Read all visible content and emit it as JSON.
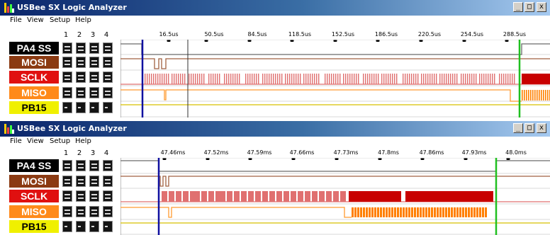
{
  "windows": [
    {
      "title": "USBee SX Logic Analyzer",
      "menu": [
        "File",
        "View",
        "Setup",
        "Help"
      ],
      "controls": [
        "_",
        "□",
        "x"
      ],
      "trigger_columns": [
        "1",
        "2",
        "3",
        "4"
      ],
      "time_ticks": [
        "16.5us",
        "50.5us",
        "84.5us",
        "118.5us",
        "152.5us",
        "186.5us",
        "220.5us",
        "254.5us",
        "288.5us"
      ],
      "signals": [
        {
          "label": "PA4 SS",
          "bg": "#000000",
          "fg": "#ffffff",
          "trig": [
            "hi",
            "hi",
            "hi",
            "hi"
          ]
        },
        {
          "label": "MOSI",
          "bg": "#8b3a12",
          "fg": "#ffffff",
          "trig": [
            "hi",
            "hi",
            "hi",
            "hi"
          ]
        },
        {
          "label": "SCLK",
          "bg": "#e01010",
          "fg": "#ffffff",
          "trig": [
            "hi",
            "hi",
            "hi",
            "hi"
          ]
        },
        {
          "label": "MISO",
          "bg": "#ff8a1a",
          "fg": "#ffffff",
          "trig": [
            "hi",
            "hi",
            "hi",
            "hi"
          ]
        },
        {
          "label": "PB15",
          "bg": "#f0f000",
          "fg": "#000000",
          "trig": [
            "dc",
            "dc",
            "dc",
            "dc"
          ]
        }
      ]
    },
    {
      "title": "USBee SX Logic Analyzer",
      "menu": [
        "File",
        "View",
        "Setup",
        "Help"
      ],
      "controls": [
        "_",
        "□",
        "x"
      ],
      "trigger_columns": [
        "1",
        "2",
        "3",
        "4"
      ],
      "time_ticks": [
        "47.46ms",
        "47.52ms",
        "47.59ms",
        "47.66ms",
        "47.73ms",
        "47.8ms",
        "47.86ms",
        "47.93ms",
        "48.0ms"
      ],
      "signals": [
        {
          "label": "PA4 SS",
          "bg": "#000000",
          "fg": "#ffffff",
          "trig": [
            "hi",
            "hi",
            "hi",
            "hi"
          ]
        },
        {
          "label": "MOSI",
          "bg": "#8b3a12",
          "fg": "#ffffff",
          "trig": [
            "hi",
            "hi",
            "hi",
            "hi"
          ]
        },
        {
          "label": "SCLK",
          "bg": "#e01010",
          "fg": "#ffffff",
          "trig": [
            "hi",
            "hi",
            "hi",
            "hi"
          ]
        },
        {
          "label": "MISO",
          "bg": "#ff8a1a",
          "fg": "#ffffff",
          "trig": [
            "hi",
            "hi",
            "hi",
            "hi"
          ]
        },
        {
          "label": "PB15",
          "bg": "#f0f000",
          "fg": "#000000",
          "trig": [
            "dc",
            "dc",
            "dc",
            "dc"
          ]
        }
      ]
    }
  ],
  "colors": {
    "ss_line": "#6b6b6b",
    "mosi_line": "#a06040",
    "sclk_fill": "#c80000",
    "sclk_pulse": "#e07070",
    "miso_line": "#ff9a30",
    "miso_fill": "#ff8000",
    "pb15_line": "#d8c000",
    "cursor_blue": "#1010a0",
    "cursor_green": "#20c020"
  }
}
